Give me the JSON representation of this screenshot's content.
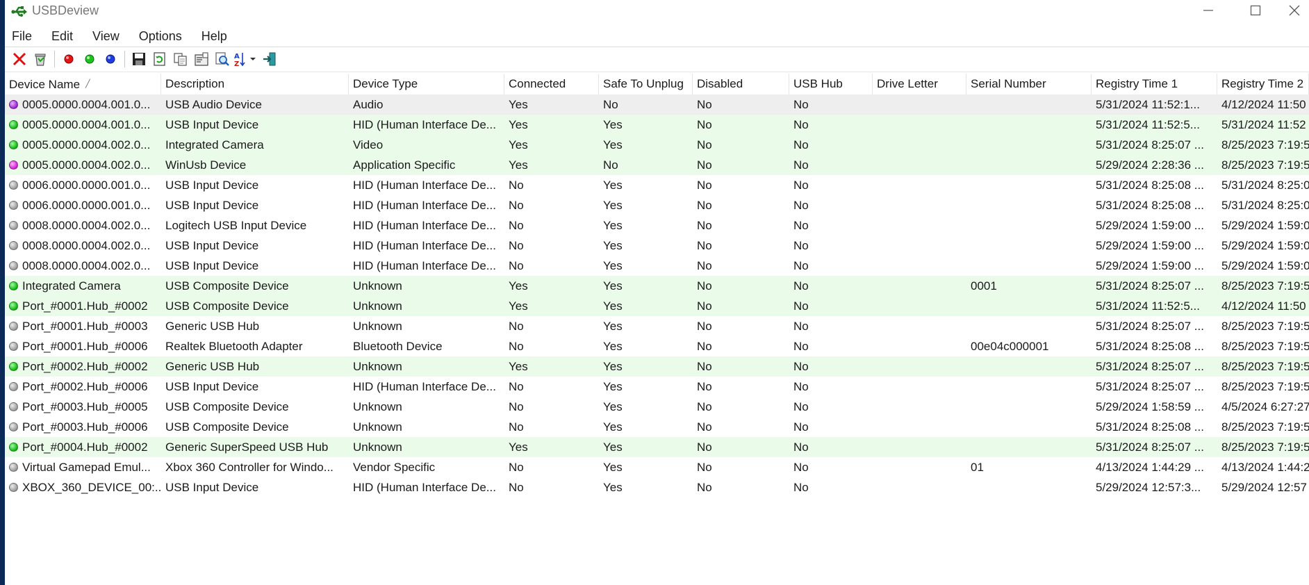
{
  "window": {
    "title": "USBDeview"
  },
  "menu": [
    "File",
    "Edit",
    "View",
    "Options",
    "Help"
  ],
  "toolbar": {
    "buttons": [
      "uninstall-icon",
      "cleanup-icon",
      "disconnect-icon",
      "connect-icon",
      "reconnect-icon",
      "save-icon",
      "refresh-icon",
      "copy-icon",
      "properties-icon",
      "find-icon",
      "sort-icon",
      "exit-icon"
    ]
  },
  "colors": {
    "connected_row": "#eafbea",
    "selected_row": "#eeeeee",
    "title_text": "#777777"
  },
  "table": {
    "columns": [
      "Device Name",
      "Description",
      "Device Type",
      "Connected",
      "Safe To Unplug",
      "Disabled",
      "USB Hub",
      "Drive Letter",
      "Serial Number",
      "Registry Time 1",
      "Registry Time 2"
    ],
    "rows": [
      {
        "status": "purple",
        "highlight": "selected",
        "cells": [
          "0005.0000.0004.001.0...",
          "USB Audio Device",
          "Audio",
          "Yes",
          "No",
          "No",
          "No",
          "",
          "",
          "5/31/2024 11:52:1...",
          "4/12/2024 11:50"
        ]
      },
      {
        "status": "green",
        "highlight": "connected",
        "cells": [
          "0005.0000.0004.001.0...",
          "USB Input Device",
          "HID (Human Interface De...",
          "Yes",
          "Yes",
          "No",
          "No",
          "",
          "",
          "5/31/2024 11:52:5...",
          "5/31/2024 11:52"
        ]
      },
      {
        "status": "green",
        "highlight": "connected",
        "cells": [
          "0005.0000.0004.002.0...",
          "Integrated Camera",
          "Video",
          "Yes",
          "Yes",
          "No",
          "No",
          "",
          "",
          "5/31/2024 8:25:07 ...",
          "8/25/2023 7:19:5"
        ]
      },
      {
        "status": "magenta",
        "highlight": "connected",
        "cells": [
          "0005.0000.0004.002.0...",
          "WinUsb Device",
          "Application Specific",
          "Yes",
          "No",
          "No",
          "No",
          "",
          "",
          "5/29/2024 2:28:36 ...",
          "8/25/2023 7:19:5"
        ]
      },
      {
        "status": "gray",
        "highlight": "none",
        "cells": [
          "0006.0000.0000.001.0...",
          "USB Input Device",
          "HID (Human Interface De...",
          "No",
          "Yes",
          "No",
          "No",
          "",
          "",
          "5/31/2024 8:25:08 ...",
          "5/31/2024 8:25:0"
        ]
      },
      {
        "status": "gray",
        "highlight": "none",
        "cells": [
          "0006.0000.0000.001.0...",
          "USB Input Device",
          "HID (Human Interface De...",
          "No",
          "Yes",
          "No",
          "No",
          "",
          "",
          "5/31/2024 8:25:08 ...",
          "5/31/2024 8:25:0"
        ]
      },
      {
        "status": "gray",
        "highlight": "none",
        "cells": [
          "0008.0000.0004.002.0...",
          "Logitech USB Input Device",
          "HID (Human Interface De...",
          "No",
          "Yes",
          "No",
          "No",
          "",
          "",
          "5/29/2024 1:59:00 ...",
          "5/29/2024 1:59:0"
        ]
      },
      {
        "status": "gray",
        "highlight": "none",
        "cells": [
          "0008.0000.0004.002.0...",
          "USB Input Device",
          "HID (Human Interface De...",
          "No",
          "Yes",
          "No",
          "No",
          "",
          "",
          "5/29/2024 1:59:00 ...",
          "5/29/2024 1:59:0"
        ]
      },
      {
        "status": "gray",
        "highlight": "none",
        "cells": [
          "0008.0000.0004.002.0...",
          "USB Input Device",
          "HID (Human Interface De...",
          "No",
          "Yes",
          "No",
          "No",
          "",
          "",
          "5/29/2024 1:59:00 ...",
          "5/29/2024 1:59:0"
        ]
      },
      {
        "status": "green",
        "highlight": "connected",
        "cells": [
          "Integrated Camera",
          "USB Composite Device",
          "Unknown",
          "Yes",
          "Yes",
          "No",
          "No",
          "",
          "0001",
          "5/31/2024 8:25:07 ...",
          "8/25/2023 7:19:5"
        ]
      },
      {
        "status": "green",
        "highlight": "connected",
        "cells": [
          "Port_#0001.Hub_#0002",
          "USB Composite Device",
          "Unknown",
          "Yes",
          "Yes",
          "No",
          "No",
          "",
          "",
          "5/31/2024 11:52:5...",
          "4/12/2024 11:50"
        ]
      },
      {
        "status": "gray",
        "highlight": "none",
        "cells": [
          "Port_#0001.Hub_#0003",
          "Generic USB Hub",
          "Unknown",
          "No",
          "Yes",
          "No",
          "No",
          "",
          "",
          "5/31/2024 8:25:07 ...",
          "8/25/2023 7:19:5"
        ]
      },
      {
        "status": "gray",
        "highlight": "none",
        "cells": [
          "Port_#0001.Hub_#0006",
          "Realtek Bluetooth Adapter",
          "Bluetooth Device",
          "No",
          "Yes",
          "No",
          "No",
          "",
          "00e04c000001",
          "5/31/2024 8:25:08 ...",
          "8/25/2023 7:19:5"
        ]
      },
      {
        "status": "green",
        "highlight": "connected",
        "cells": [
          "Port_#0002.Hub_#0002",
          "Generic USB Hub",
          "Unknown",
          "Yes",
          "Yes",
          "No",
          "No",
          "",
          "",
          "5/31/2024 8:25:07 ...",
          "8/25/2023 7:19:5"
        ]
      },
      {
        "status": "gray",
        "highlight": "none",
        "cells": [
          "Port_#0002.Hub_#0006",
          "USB Input Device",
          "HID (Human Interface De...",
          "No",
          "Yes",
          "No",
          "No",
          "",
          "",
          "5/31/2024 8:25:07 ...",
          "8/25/2023 7:19:5"
        ]
      },
      {
        "status": "gray",
        "highlight": "none",
        "cells": [
          "Port_#0003.Hub_#0005",
          "USB Composite Device",
          "Unknown",
          "No",
          "Yes",
          "No",
          "No",
          "",
          "",
          "5/29/2024 1:58:59 ...",
          "4/5/2024 6:27:27"
        ]
      },
      {
        "status": "gray",
        "highlight": "none",
        "cells": [
          "Port_#0003.Hub_#0006",
          "USB Composite Device",
          "Unknown",
          "No",
          "Yes",
          "No",
          "No",
          "",
          "",
          "5/31/2024 8:25:08 ...",
          "8/25/2023 7:19:5"
        ]
      },
      {
        "status": "green",
        "highlight": "connected",
        "cells": [
          "Port_#0004.Hub_#0002",
          "Generic SuperSpeed USB Hub",
          "Unknown",
          "Yes",
          "Yes",
          "No",
          "No",
          "",
          "",
          "5/31/2024 8:25:07 ...",
          "8/25/2023 7:19:5"
        ]
      },
      {
        "status": "gray",
        "highlight": "none",
        "cells": [
          "Virtual Gamepad Emul...",
          "Xbox 360 Controller for Windo...",
          "Vendor Specific",
          "No",
          "Yes",
          "No",
          "No",
          "",
          "01",
          "4/13/2024 1:44:29 ...",
          "4/13/2024 1:44:2"
        ]
      },
      {
        "status": "gray",
        "highlight": "none",
        "cells": [
          "XBOX_360_DEVICE_00:...",
          "USB Input Device",
          "HID (Human Interface De...",
          "No",
          "Yes",
          "No",
          "No",
          "",
          "",
          "5/29/2024 12:57:3...",
          "5/29/2024 12:57"
        ]
      }
    ]
  }
}
